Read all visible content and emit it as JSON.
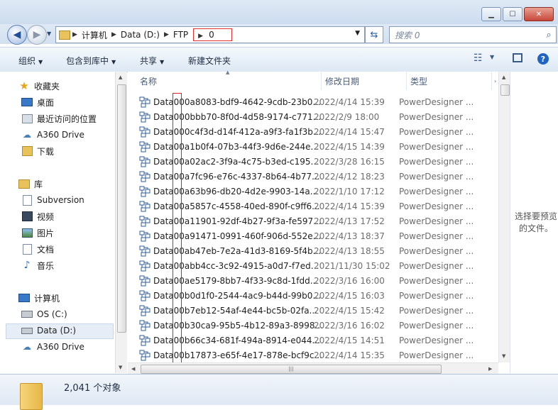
{
  "window": {
    "min_glyph": "▁",
    "max_glyph": "☐",
    "close_glyph": "✕"
  },
  "address": {
    "crumbs": [
      "计算机",
      "Data (D:)",
      "FTP"
    ],
    "current": "0",
    "search_placeholder": "搜索 0"
  },
  "toolbar": {
    "organize": "组织",
    "include_in_library": "包含到库中",
    "share": "共享",
    "new_folder": "新建文件夹",
    "help": "?"
  },
  "sidebar": {
    "favorites": {
      "label": "收藏夹",
      "items": [
        "桌面",
        "最近访问的位置",
        "A360 Drive",
        "下载"
      ]
    },
    "libraries": {
      "label": "库",
      "items": [
        "Subversion",
        "视频",
        "图片",
        "文档",
        "音乐"
      ]
    },
    "computer": {
      "label": "计算机",
      "items": [
        "OS (C:)",
        "Data (D:)",
        "A360 Drive"
      ]
    },
    "selected": "Data (D:)"
  },
  "columns": {
    "name": "名称",
    "modified": "修改日期",
    "type": "类型"
  },
  "files": [
    {
      "name": "Data000a8083-bdf9-4642-9cdb-23b0...",
      "date": "2022/4/14 15:39",
      "type": "PowerDesigner ..."
    },
    {
      "name": "Data000bbb70-8f0d-4d58-9174-c771...",
      "date": "2022/2/9 18:00",
      "type": "PowerDesigner ..."
    },
    {
      "name": "Data000c4f3d-d14f-412a-a9f3-fa1f3b...",
      "date": "2022/4/14 15:47",
      "type": "PowerDesigner ..."
    },
    {
      "name": "Data00a1b0f4-07b3-44f3-9d6e-244e...",
      "date": "2022/4/15 14:39",
      "type": "PowerDesigner ..."
    },
    {
      "name": "Data00a02ac2-3f9a-4c75-b3ed-c195...",
      "date": "2022/3/28 16:15",
      "type": "PowerDesigner ..."
    },
    {
      "name": "Data00a7fc96-e76c-4337-8b64-4b77...",
      "date": "2022/4/12 18:23",
      "type": "PowerDesigner ..."
    },
    {
      "name": "Data00a63b96-db20-4d2e-9903-14a...",
      "date": "2022/1/10 17:12",
      "type": "PowerDesigner ..."
    },
    {
      "name": "Data00a5857c-4558-40ed-890f-c9ff6...",
      "date": "2022/4/14 15:39",
      "type": "PowerDesigner ..."
    },
    {
      "name": "Data00a11901-92df-4b27-9f3a-fe597...",
      "date": "2022/4/13 17:52",
      "type": "PowerDesigner ..."
    },
    {
      "name": "Data00a91471-0991-460f-906d-552e...",
      "date": "2022/4/13 18:37",
      "type": "PowerDesigner ..."
    },
    {
      "name": "Data00ab47eb-7e2a-41d3-8169-5f4b...",
      "date": "2022/4/13 18:55",
      "type": "PowerDesigner ..."
    },
    {
      "name": "Data00abb4cc-3c92-4915-a0d7-f7ed...",
      "date": "2021/11/30 15:02",
      "type": "PowerDesigner ..."
    },
    {
      "name": "Data00ae5179-8bb7-4f33-9c8d-1fdd...",
      "date": "2022/3/16 16:00",
      "type": "PowerDesigner ..."
    },
    {
      "name": "Data00b0d1f0-2544-4ac9-b44d-99b0...",
      "date": "2022/4/15 16:03",
      "type": "PowerDesigner ..."
    },
    {
      "name": "Data00b7eb12-54af-4e44-bc5b-02fa...",
      "date": "2022/4/15 15:42",
      "type": "PowerDesigner ..."
    },
    {
      "name": "Data00b30ca9-95b5-4b12-89a3-8998...",
      "date": "2022/3/16 16:02",
      "type": "PowerDesigner ..."
    },
    {
      "name": "Data00b66c34-681f-494a-8914-e044...",
      "date": "2022/4/15 14:51",
      "type": "PowerDesigner ..."
    },
    {
      "name": "Data00b17873-e65f-4e17-878e-bcf9c...",
      "date": "2022/4/14 15:35",
      "type": "PowerDesigner ..."
    }
  ],
  "preview_text": "选择要预览的文件。",
  "status": {
    "count": "2,041 个对象"
  },
  "colors": {
    "highlight_red": "#e02020",
    "selected_bg": "#e6edf7",
    "accent_blue": "#1f63c5"
  }
}
